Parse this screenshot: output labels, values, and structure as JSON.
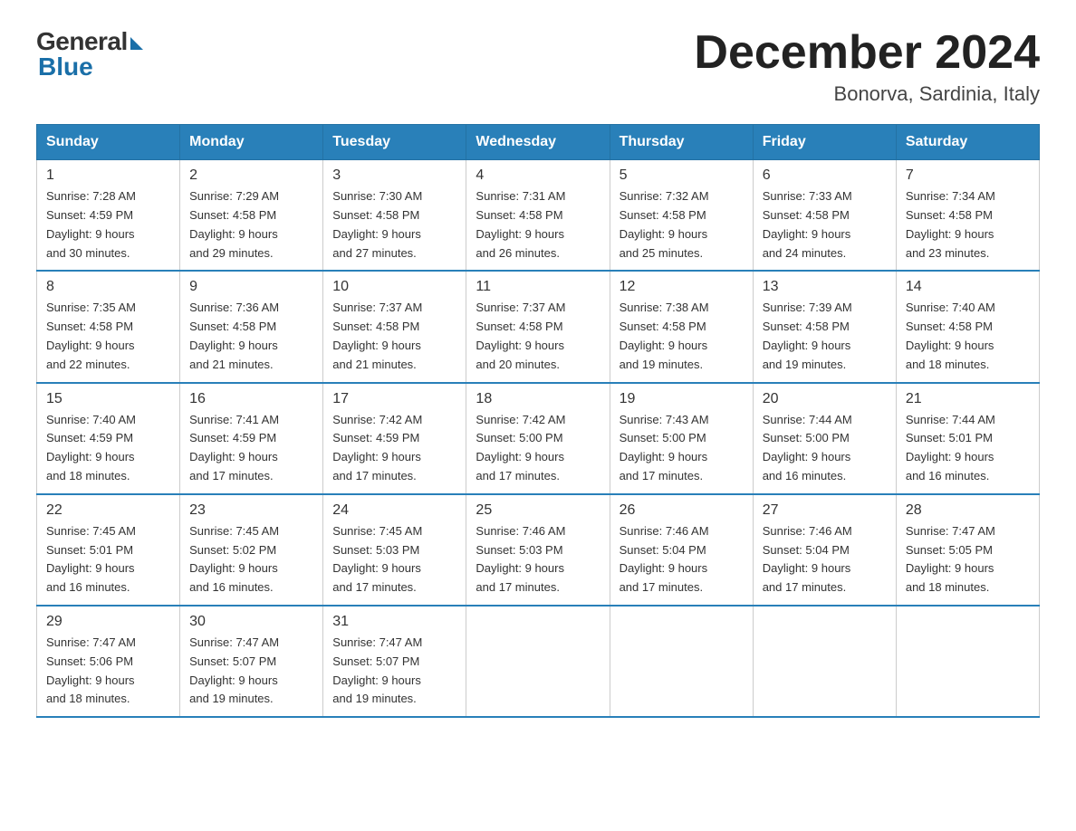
{
  "logo": {
    "general": "General",
    "blue": "Blue"
  },
  "title": "December 2024",
  "location": "Bonorva, Sardinia, Italy",
  "days_of_week": [
    "Sunday",
    "Monday",
    "Tuesday",
    "Wednesday",
    "Thursday",
    "Friday",
    "Saturday"
  ],
  "weeks": [
    [
      {
        "day": "1",
        "sunrise": "7:28 AM",
        "sunset": "4:59 PM",
        "daylight": "9 hours and 30 minutes."
      },
      {
        "day": "2",
        "sunrise": "7:29 AM",
        "sunset": "4:58 PM",
        "daylight": "9 hours and 29 minutes."
      },
      {
        "day": "3",
        "sunrise": "7:30 AM",
        "sunset": "4:58 PM",
        "daylight": "9 hours and 27 minutes."
      },
      {
        "day": "4",
        "sunrise": "7:31 AM",
        "sunset": "4:58 PM",
        "daylight": "9 hours and 26 minutes."
      },
      {
        "day": "5",
        "sunrise": "7:32 AM",
        "sunset": "4:58 PM",
        "daylight": "9 hours and 25 minutes."
      },
      {
        "day": "6",
        "sunrise": "7:33 AM",
        "sunset": "4:58 PM",
        "daylight": "9 hours and 24 minutes."
      },
      {
        "day": "7",
        "sunrise": "7:34 AM",
        "sunset": "4:58 PM",
        "daylight": "9 hours and 23 minutes."
      }
    ],
    [
      {
        "day": "8",
        "sunrise": "7:35 AM",
        "sunset": "4:58 PM",
        "daylight": "9 hours and 22 minutes."
      },
      {
        "day": "9",
        "sunrise": "7:36 AM",
        "sunset": "4:58 PM",
        "daylight": "9 hours and 21 minutes."
      },
      {
        "day": "10",
        "sunrise": "7:37 AM",
        "sunset": "4:58 PM",
        "daylight": "9 hours and 21 minutes."
      },
      {
        "day": "11",
        "sunrise": "7:37 AM",
        "sunset": "4:58 PM",
        "daylight": "9 hours and 20 minutes."
      },
      {
        "day": "12",
        "sunrise": "7:38 AM",
        "sunset": "4:58 PM",
        "daylight": "9 hours and 19 minutes."
      },
      {
        "day": "13",
        "sunrise": "7:39 AM",
        "sunset": "4:58 PM",
        "daylight": "9 hours and 19 minutes."
      },
      {
        "day": "14",
        "sunrise": "7:40 AM",
        "sunset": "4:58 PM",
        "daylight": "9 hours and 18 minutes."
      }
    ],
    [
      {
        "day": "15",
        "sunrise": "7:40 AM",
        "sunset": "4:59 PM",
        "daylight": "9 hours and 18 minutes."
      },
      {
        "day": "16",
        "sunrise": "7:41 AM",
        "sunset": "4:59 PM",
        "daylight": "9 hours and 17 minutes."
      },
      {
        "day": "17",
        "sunrise": "7:42 AM",
        "sunset": "4:59 PM",
        "daylight": "9 hours and 17 minutes."
      },
      {
        "day": "18",
        "sunrise": "7:42 AM",
        "sunset": "5:00 PM",
        "daylight": "9 hours and 17 minutes."
      },
      {
        "day": "19",
        "sunrise": "7:43 AM",
        "sunset": "5:00 PM",
        "daylight": "9 hours and 17 minutes."
      },
      {
        "day": "20",
        "sunrise": "7:44 AM",
        "sunset": "5:00 PM",
        "daylight": "9 hours and 16 minutes."
      },
      {
        "day": "21",
        "sunrise": "7:44 AM",
        "sunset": "5:01 PM",
        "daylight": "9 hours and 16 minutes."
      }
    ],
    [
      {
        "day": "22",
        "sunrise": "7:45 AM",
        "sunset": "5:01 PM",
        "daylight": "9 hours and 16 minutes."
      },
      {
        "day": "23",
        "sunrise": "7:45 AM",
        "sunset": "5:02 PM",
        "daylight": "9 hours and 16 minutes."
      },
      {
        "day": "24",
        "sunrise": "7:45 AM",
        "sunset": "5:03 PM",
        "daylight": "9 hours and 17 minutes."
      },
      {
        "day": "25",
        "sunrise": "7:46 AM",
        "sunset": "5:03 PM",
        "daylight": "9 hours and 17 minutes."
      },
      {
        "day": "26",
        "sunrise": "7:46 AM",
        "sunset": "5:04 PM",
        "daylight": "9 hours and 17 minutes."
      },
      {
        "day": "27",
        "sunrise": "7:46 AM",
        "sunset": "5:04 PM",
        "daylight": "9 hours and 17 minutes."
      },
      {
        "day": "28",
        "sunrise": "7:47 AM",
        "sunset": "5:05 PM",
        "daylight": "9 hours and 18 minutes."
      }
    ],
    [
      {
        "day": "29",
        "sunrise": "7:47 AM",
        "sunset": "5:06 PM",
        "daylight": "9 hours and 18 minutes."
      },
      {
        "day": "30",
        "sunrise": "7:47 AM",
        "sunset": "5:07 PM",
        "daylight": "9 hours and 19 minutes."
      },
      {
        "day": "31",
        "sunrise": "7:47 AM",
        "sunset": "5:07 PM",
        "daylight": "9 hours and 19 minutes."
      },
      null,
      null,
      null,
      null
    ]
  ],
  "labels": {
    "sunrise": "Sunrise:",
    "sunset": "Sunset:",
    "daylight": "Daylight:"
  }
}
